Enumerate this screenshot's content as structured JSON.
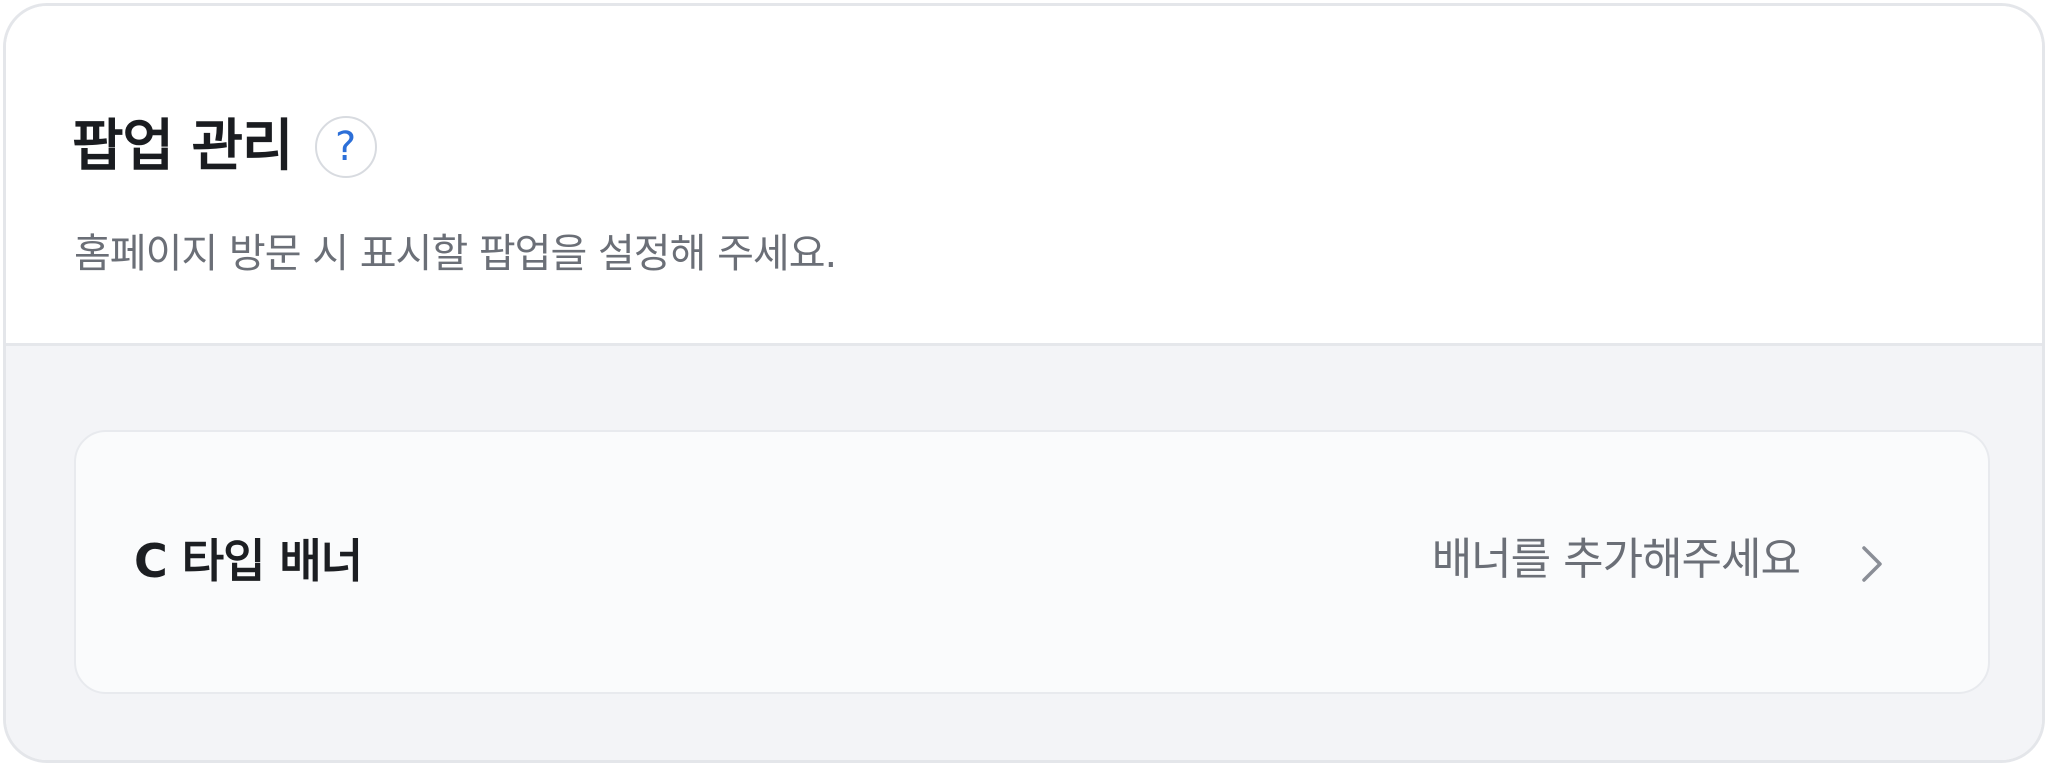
{
  "header": {
    "title": "팝업 관리",
    "help_icon": "?",
    "subtitle": "홈페이지 방문 시 표시할 팝업을 설정해 주세요."
  },
  "banner_row": {
    "label": "C 타입 배너",
    "status": "배너를 추가해주세요",
    "chevron": "chevron-right-icon"
  },
  "colors": {
    "title": "#1a1c20",
    "help_accent": "#2c6fd8",
    "muted_text": "#6b6f77",
    "body_bg": "#f3f4f7",
    "row_bg": "#fafbfc"
  }
}
